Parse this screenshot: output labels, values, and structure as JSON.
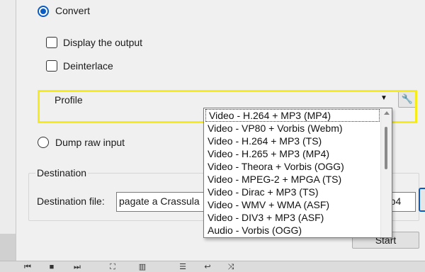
{
  "options": {
    "convert_label": "Convert",
    "display_output_label": "Display the output",
    "deinterlace_label": "Deinterlace",
    "profile_label": "Profile",
    "dump_raw_label": "Dump raw input"
  },
  "profile": {
    "items": [
      "Video - H.264 + MP3 (MP4)",
      "Video - VP80 + Vorbis (Webm)",
      "Video - H.264 + MP3 (TS)",
      "Video - H.265 + MP3 (MP4)",
      "Video - Theora + Vorbis (OGG)",
      "Video - MPEG-2 + MPGA (TS)",
      "Video - Dirac + MP3 (TS)",
      "Video - WMV + WMA (ASF)",
      "Video - DIV3 + MP3 (ASF)",
      "Audio - Vorbis (OGG)"
    ]
  },
  "destination": {
    "group_label": "Destination",
    "file_label": "Destination file:",
    "file_value": "pagate a Crassula",
    "file_value_tail": "mp4"
  },
  "actions": {
    "start_label": "Start"
  },
  "icons": {
    "wrench": "wrench-icon",
    "dropdown_arrow": "chevron-down-icon"
  },
  "colors": {
    "highlight": "#f5ec1a",
    "accent": "#0a5cc2"
  }
}
